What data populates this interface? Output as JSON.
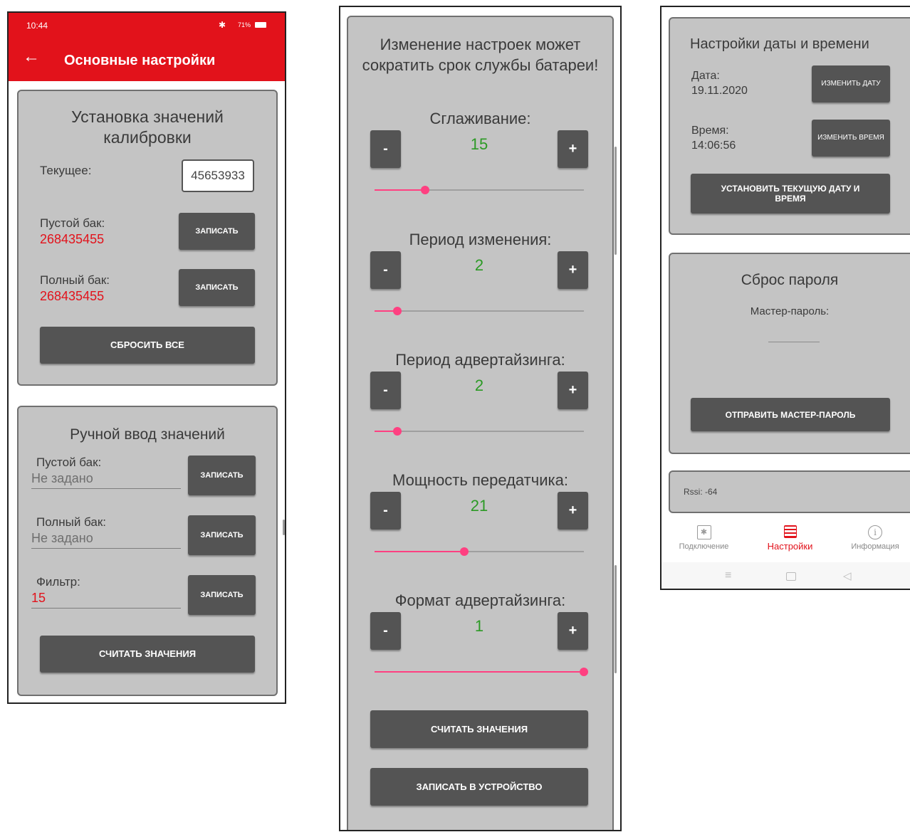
{
  "colors": {
    "accent_red": "#e2121b",
    "card_bg": "#c4c4c4",
    "button_bg": "#545454",
    "value_green": "#2c9a25",
    "slider_pink": "#ff4081"
  },
  "phone1": {
    "status": {
      "time": "10:44",
      "battery": "71%"
    },
    "appbar": {
      "back_icon": "arrow-left-icon",
      "title": "Основные настройки"
    },
    "calibration": {
      "title": "Установка значений калибровки",
      "current_label": "Текущее:",
      "current_value": "45653933",
      "empty_label": "Пустой бак:",
      "empty_value": "268435455",
      "full_label": "Полный бак:",
      "full_value": "268435455",
      "write_label": "ЗАПИСАТЬ",
      "reset_all_label": "СБРОСИТЬ ВСЕ"
    },
    "manual": {
      "title": "Ручной ввод значений",
      "empty_label": "Пустой бак:",
      "empty_placeholder": "Не задано",
      "full_label": "Полный бак:",
      "full_placeholder": "Не задано",
      "filter_label": "Фильтр:",
      "filter_value": "15",
      "write_label": "ЗАПИСАТЬ",
      "read_label": "СЧИТАТЬ ЗНАЧЕНИЯ"
    }
  },
  "phone2": {
    "warning": "Изменение настроек может сократить срок службы батареи!",
    "minus_label": "-",
    "plus_label": "+",
    "settings": [
      {
        "label": "Сглаживание:",
        "value": "15",
        "fraction": 0.24
      },
      {
        "label": "Период изменения:",
        "value": "2",
        "fraction": 0.11
      },
      {
        "label": "Период адвертайзинга:",
        "value": "2",
        "fraction": 0.11
      },
      {
        "label": "Мощность передатчика:",
        "value": "21",
        "fraction": 0.43
      },
      {
        "label": "Формат адвертайзинга:",
        "value": "1",
        "fraction": 1.0
      }
    ],
    "read_label": "СЧИТАТЬ ЗНАЧЕНИЯ",
    "write_device_label": "ЗАПИСАТЬ В УСТРОЙСТВО"
  },
  "phone3": {
    "datetime": {
      "title": "Настройки даты и времени",
      "date_label": "Дата:",
      "date_value": "19.11.2020",
      "change_date_label": "ИЗМЕНИТЬ ДАТУ",
      "time_label": "Время:",
      "time_value": "14:06:56",
      "change_time_label": "ИЗМЕНИТЬ ВРЕМЯ",
      "set_current_label": "УСТАНОВИТЬ ТЕКУЩУЮ ДАТУ И ВРЕМЯ"
    },
    "password": {
      "title": "Сброс пароля",
      "master_label": "Мастер-пароль:",
      "send_label": "ОТПРАВИТЬ МАСТЕР-ПАРОЛЬ"
    },
    "rssi": "Rssi: -64",
    "nav": [
      {
        "label": "Подключение",
        "icon": "bluetooth-icon"
      },
      {
        "label": "Настройки",
        "icon": "settings-grid-icon"
      },
      {
        "label": "Информация",
        "icon": "info-icon"
      }
    ]
  }
}
